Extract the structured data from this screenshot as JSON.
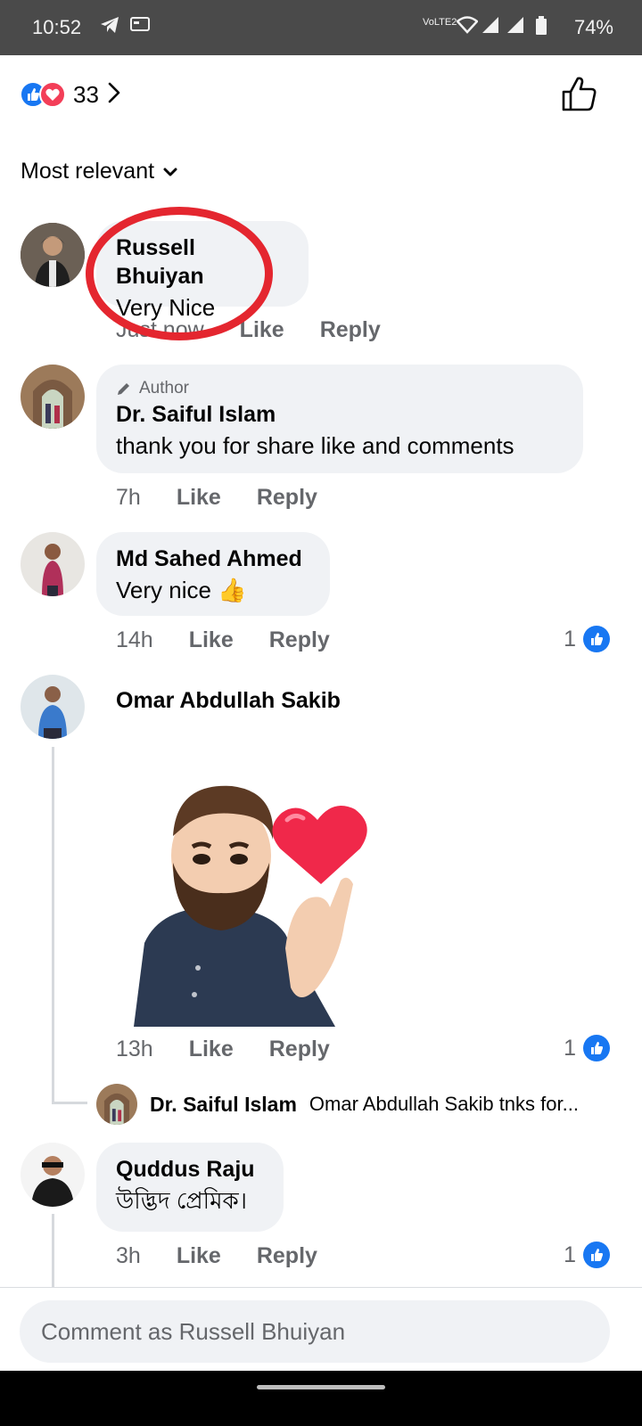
{
  "status_bar": {
    "time": "10:52",
    "battery": "74%",
    "network": "VoLTE2"
  },
  "header": {
    "reaction_count": "33",
    "reaction_icons": [
      "like-icon",
      "love-icon"
    ]
  },
  "sort": {
    "label": "Most relevant"
  },
  "comments": [
    {
      "name": "Russell Bhuiyan",
      "text": "Very Nice",
      "time": "Just now",
      "like": "Like",
      "reply": "Reply"
    },
    {
      "author_tag": "Author",
      "name": "Dr. Saiful Islam",
      "text": "thank you for share like and comments",
      "time": "7h",
      "like": "Like",
      "reply": "Reply"
    },
    {
      "name": "Md Sahed Ahmed",
      "text": "Very nice 👍",
      "time": "14h",
      "like": "Like",
      "reply": "Reply",
      "likes": "1"
    },
    {
      "name": "Omar Abdullah Sakib",
      "time": "13h",
      "like": "Like",
      "reply": "Reply",
      "likes": "1"
    },
    {
      "name": "Quddus Raju",
      "text": "উদ্ভিদ প্রেমিক।",
      "time": "3h",
      "like": "Like",
      "reply": "Reply",
      "likes": "1"
    }
  ],
  "reply_preview": {
    "name": "Dr. Saiful Islam",
    "text": "Omar Abdullah Sakib tnks for..."
  },
  "input": {
    "placeholder": "Comment as Russell Bhuiyan"
  },
  "colors": {
    "accent": "#1877f2",
    "love": "#f33e58",
    "annotation": "#e4262f"
  }
}
